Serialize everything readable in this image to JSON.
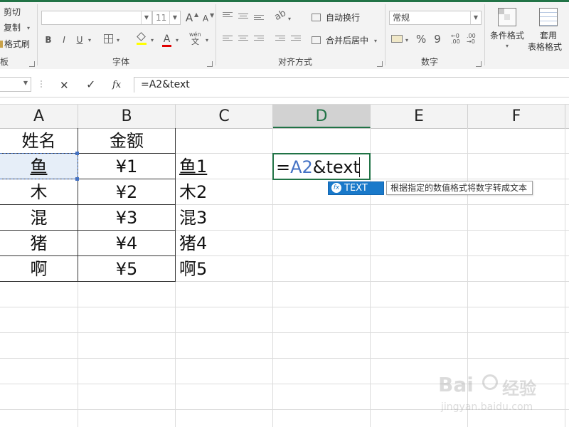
{
  "ribbon": {
    "clipboard": {
      "cut": "剪切",
      "copy": "复制",
      "copy_arrow": "▾",
      "format_painter": "格式刷",
      "group": "板"
    },
    "font": {
      "font_size": "11",
      "grow": "A",
      "shrink": "A",
      "bold": "B",
      "italic": "I",
      "underline": "U",
      "font_color_letter": "A",
      "wen": "wén",
      "wen_char": "文",
      "group": "字体"
    },
    "alignment": {
      "wrap_text": "自动换行",
      "merge_center": "合并后居中",
      "group": "对齐方式"
    },
    "number": {
      "format": "常规",
      "percent": "%",
      "comma": "9",
      "group": "数字"
    },
    "styles": {
      "conditional": "条件格式",
      "table_format_1": "套用",
      "table_format_2": "表格格式"
    }
  },
  "formula_bar": {
    "cancel": "✕",
    "enter": "✓",
    "fx": "fx",
    "content": "=A2&text"
  },
  "columns": [
    "A",
    "B",
    "C",
    "D",
    "E",
    "F"
  ],
  "active_column": "D",
  "table": {
    "headers": [
      "姓名",
      "金额"
    ],
    "rows": [
      {
        "name": "鱼",
        "amount": "¥1"
      },
      {
        "name": "木",
        "amount": "¥2"
      },
      {
        "name": "混",
        "amount": "¥3"
      },
      {
        "name": "猪",
        "amount": "¥4"
      },
      {
        "name": "啊",
        "amount": "¥5"
      }
    ]
  },
  "column_c": [
    "鱼1",
    "木2",
    "混3",
    "猪4",
    "啊5"
  ],
  "editing_cell": {
    "eq": "=",
    "ref": "A2",
    "rest": "&text",
    "ref_color": "#4472c4"
  },
  "autocomplete": {
    "icon_label": "fx",
    "function": "TEXT",
    "tooltip": "根据指定的数值格式将数字转成文本"
  },
  "watermark": {
    "brand_left": "Bai",
    "brand_right": "经验",
    "url": "jingyan.baidu.com"
  },
  "colors": {
    "accent": "#217346",
    "selection": "#1979ca"
  }
}
